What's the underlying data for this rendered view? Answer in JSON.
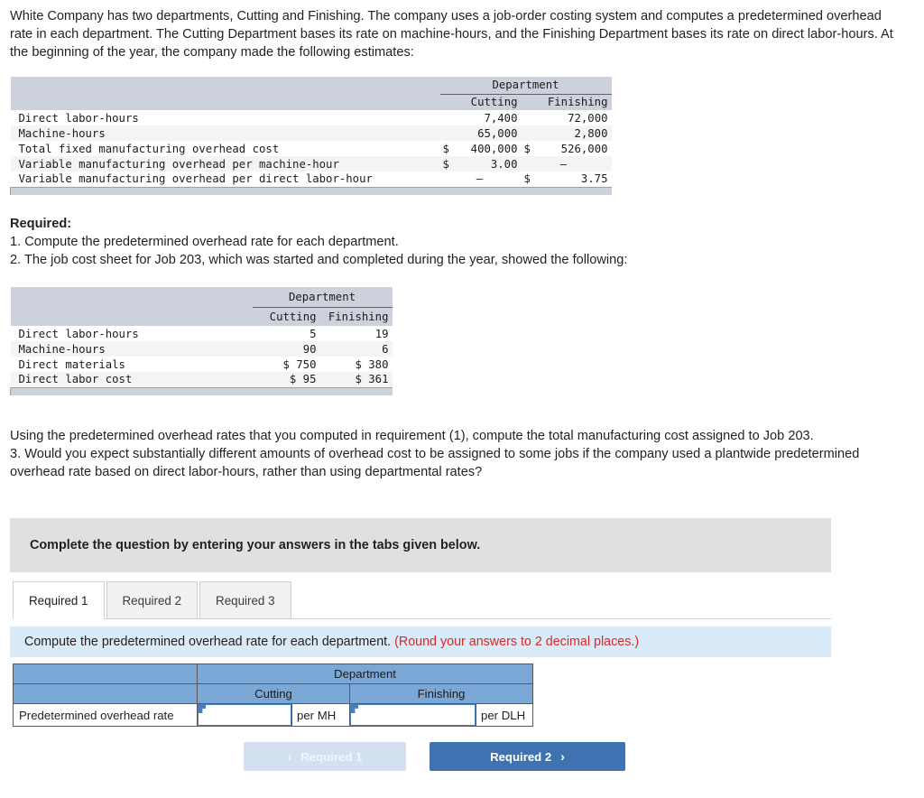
{
  "intro": {
    "paragraph": "White Company has two departments, Cutting and Finishing. The company uses a job-order costing system and computes a predetermined overhead rate in each department. The Cutting Department bases its rate on machine-hours, and the Finishing Department bases its rate on direct labor-hours. At the beginning of the year, the company made the following estimates:"
  },
  "estimates_table": {
    "group_header": "Department",
    "columns": [
      "Cutting",
      "Finishing"
    ],
    "rows": [
      {
        "label": "Direct labor-hours",
        "cutting_currency": "",
        "cutting": "7,400",
        "finishing_currency": "",
        "finishing": "72,000"
      },
      {
        "label": "Machine-hours",
        "cutting_currency": "",
        "cutting": "65,000",
        "finishing_currency": "",
        "finishing": "2,800"
      },
      {
        "label": "Total fixed manufacturing overhead cost",
        "cutting_currency": "$",
        "cutting": "400,000",
        "finishing_currency": "$",
        "finishing": "526,000"
      },
      {
        "label": "Variable manufacturing overhead per machine-hour",
        "cutting_currency": "$",
        "cutting": "3.00",
        "finishing_currency": "",
        "finishing": "—"
      },
      {
        "label": "Variable manufacturing overhead per direct labor-hour",
        "cutting_currency": "",
        "cutting": "—",
        "finishing_currency": "$",
        "finishing": "3.75"
      }
    ]
  },
  "required": {
    "heading": "Required:",
    "item1": "1. Compute the predetermined overhead rate for each department.",
    "item2": "2. The job cost sheet for Job 203, which was started and completed during the year, showed the following:"
  },
  "job_table": {
    "group_header": "Department",
    "columns": [
      "Cutting",
      "Finishing"
    ],
    "rows": [
      {
        "label": "Direct labor-hours",
        "cutting": "5",
        "finishing": "19"
      },
      {
        "label": "Machine-hours",
        "cutting": "90",
        "finishing": "6"
      },
      {
        "label": "Direct materials",
        "cutting": "$ 750",
        "finishing": "$ 380"
      },
      {
        "label": "Direct labor cost",
        "cutting": "$  95",
        "finishing": "$ 361"
      }
    ]
  },
  "middle": {
    "para2": "Using the predetermined overhead rates that you computed in requirement (1), compute the total manufacturing cost assigned to Job 203.",
    "item3": "3. Would you expect substantially different amounts of overhead cost to be assigned to some jobs if the company used a plantwide predetermined overhead rate based on direct labor-hours, rather than using departmental rates?"
  },
  "complete_banner": {
    "text": "Complete the question by entering your answers in the tabs given below."
  },
  "tabs": [
    {
      "label": "Required 1",
      "active": true
    },
    {
      "label": "Required 2",
      "active": false
    },
    {
      "label": "Required 3",
      "active": false
    }
  ],
  "instruction": {
    "text": "Compute the predetermined overhead rate for each department.",
    "round_note": "(Round your answers to 2 decimal places.)"
  },
  "answer_table": {
    "group_header": "Department",
    "col_cutting": "Cutting",
    "col_finishing": "Finishing",
    "row_label": "Predetermined overhead rate",
    "cutting_value": "",
    "cutting_unit": "per MH",
    "finishing_value": "",
    "finishing_unit": "per DLH"
  },
  "nav": {
    "prev_label": "Required 1",
    "prev_chevron": "‹",
    "next_label": "Required 2",
    "next_chevron": "›"
  },
  "colors": {
    "table_header_gray": "#ccd1dc",
    "banner_gray": "#e0e0e0",
    "instruction_blue": "#dbeaf7",
    "answer_header_blue": "#7ba7d7",
    "note_red": "#d32b2b",
    "next_button_blue": "#3f72b0",
    "prev_button_blue": "#d3e0f0"
  }
}
